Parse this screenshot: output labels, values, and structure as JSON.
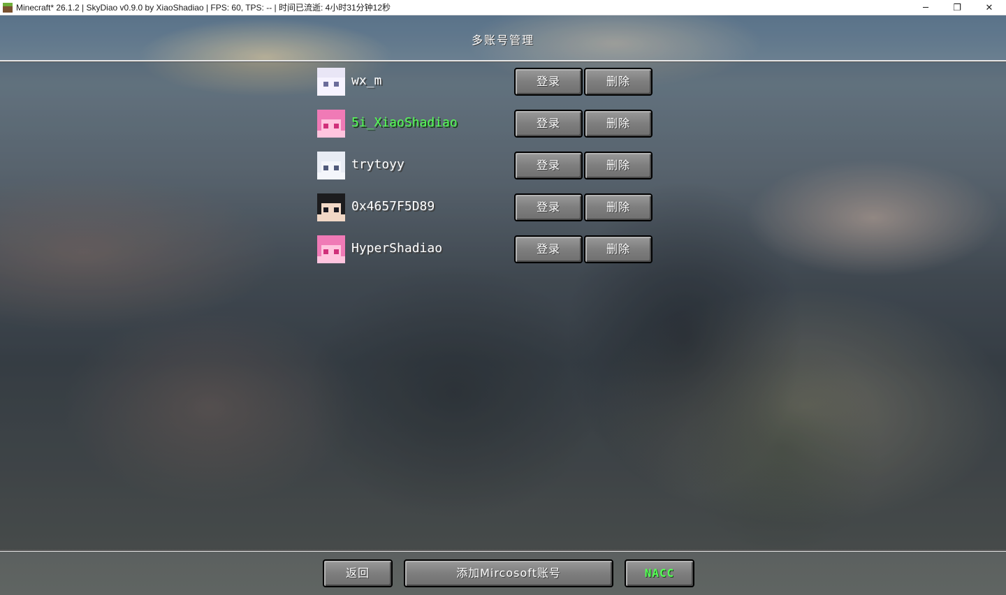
{
  "window": {
    "title": "Minecraft* 26.1.2 | SkyDiao v0.9.0  by XiaoShadiao | FPS: 60, TPS: -- | 时间已流逝: 4小时31分钟12秒",
    "minimize": "─",
    "maximize": "❐",
    "close": "✕"
  },
  "screen": {
    "title": "多账号管理"
  },
  "accounts": [
    {
      "name": "wx_m",
      "active": false,
      "login_label": "登录",
      "delete_label": "删除",
      "avatar_hair": "#e9e6f6",
      "avatar_face": "#f6f3ff",
      "avatar_eyes": "#6b6c9a"
    },
    {
      "name": "5i_XiaoShadiao",
      "active": true,
      "login_label": "登录",
      "delete_label": "删除",
      "avatar_hair": "#f07ab6",
      "avatar_face": "#ffc4de",
      "avatar_eyes": "#d0307a"
    },
    {
      "name": "trytoyy",
      "active": false,
      "login_label": "登录",
      "delete_label": "删除",
      "avatar_hair": "#e8ecf4",
      "avatar_face": "#f4f6fb",
      "avatar_eyes": "#505a7a"
    },
    {
      "name": "0x4657F5D89",
      "active": false,
      "login_label": "登录",
      "delete_label": "删除",
      "avatar_hair": "#1c1c1e",
      "avatar_face": "#f1d8c6",
      "avatar_eyes": "#1a1a22"
    },
    {
      "name": "HyperShadiao",
      "active": false,
      "login_label": "登录",
      "delete_label": "删除",
      "avatar_hair": "#f07ab6",
      "avatar_face": "#ffc4de",
      "avatar_eyes": "#d0307a"
    }
  ],
  "footer": {
    "back_label": "返回",
    "add_label": "添加Mircosoft账号",
    "nacc_label": "NACC"
  },
  "colors": {
    "active_name": "#55ff55",
    "button_text": "#ffffff"
  }
}
